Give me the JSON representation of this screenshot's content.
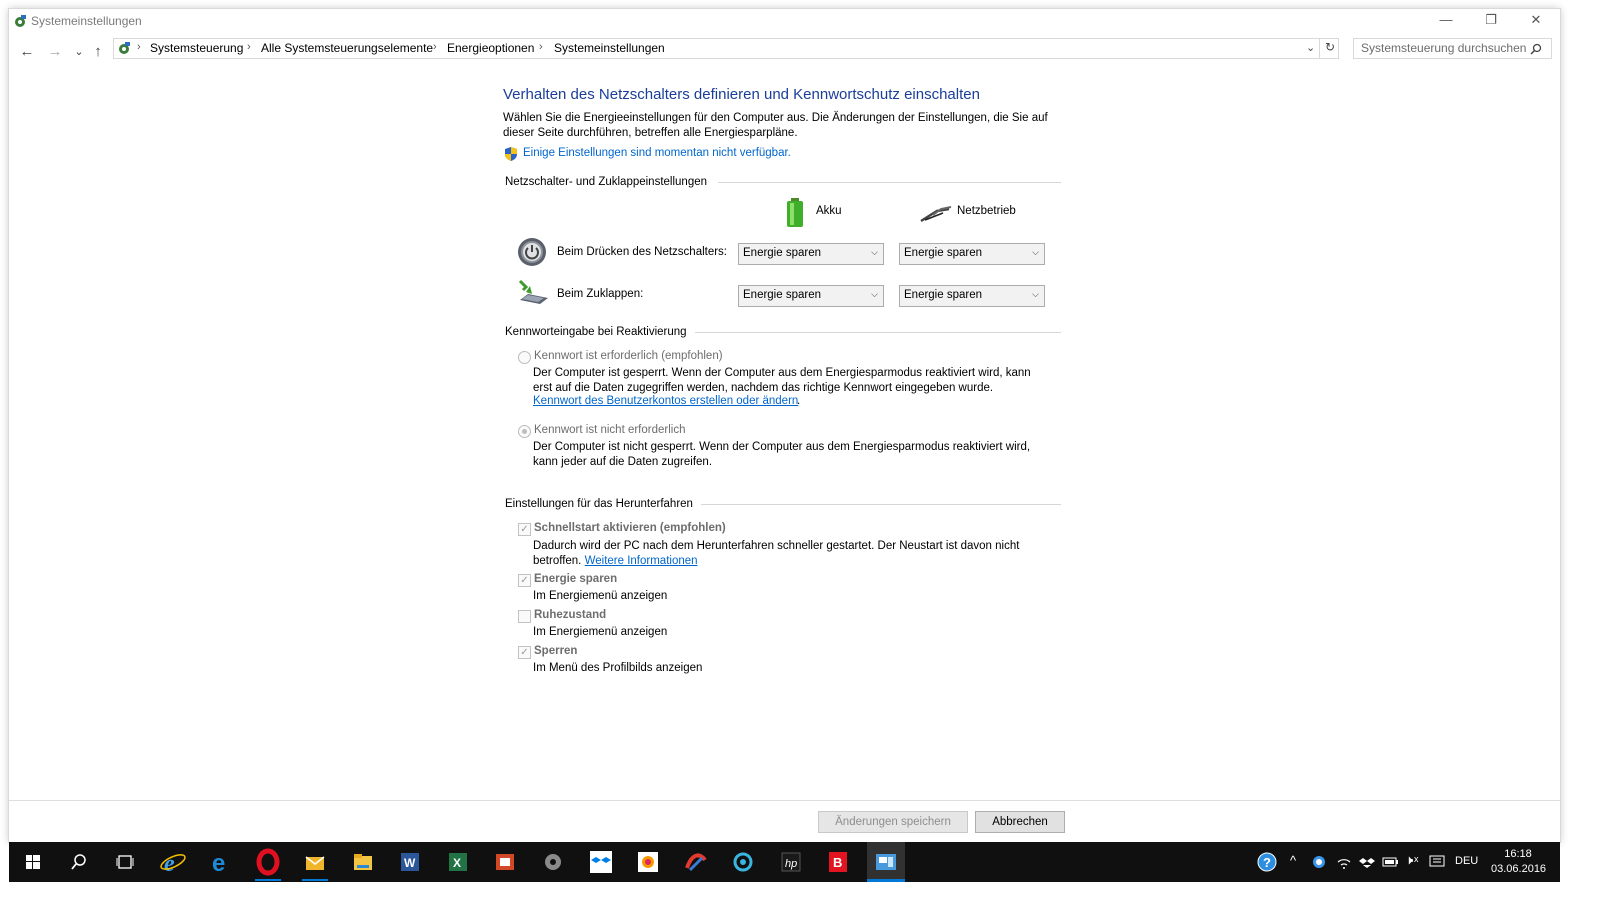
{
  "window": {
    "title": "Systemeinstellungen",
    "controls": {
      "minimize": "—",
      "restore": "❐",
      "close": "✕"
    }
  },
  "nav": {
    "back": "←",
    "forward": "→",
    "recent": "⌄",
    "up": "↑",
    "breadcrumb": [
      "Systemsteuerung",
      "Alle Systemsteuerungselemente",
      "Energieoptionen",
      "Systemeinstellungen"
    ],
    "search_placeholder": "Systemsteuerung durchsuchen"
  },
  "main": {
    "heading": "Verhalten des Netzschalters definieren und Kennwortschutz einschalten",
    "description": "Wählen Sie die Energieeinstellungen für den Computer aus. Die Änderungen der Einstellungen, die Sie auf dieser Seite durchführen, betreffen alle Energiesparpläne.",
    "admin_link": "Einige Einstellungen sind momentan nicht verfügbar.",
    "power_section": {
      "title": "Netzschalter- und Zuklappeinstellungen",
      "col_battery": "Akku",
      "col_plugged": "Netzbetrieb",
      "rows": [
        {
          "label": "Beim Drücken des Netzschalters:",
          "battery": "Energie sparen",
          "plugged": "Energie sparen"
        },
        {
          "label": "Beim Zuklappen:",
          "battery": "Energie sparen",
          "plugged": "Energie sparen"
        }
      ]
    },
    "password_section": {
      "title": "Kennworteingabe bei Reaktivierung",
      "option1_label": "Kennwort ist erforderlich (empfohlen)",
      "option1_desc": "Der Computer ist gesperrt. Wenn der Computer aus dem Energiesparmodus reaktiviert wird, kann erst auf die Daten zugegriffen werden, nachdem das richtige Kennwort eingegeben wurde.",
      "option1_link": "Kennwort des Benutzerkontos erstellen oder ändern",
      "option2_label": "Kennwort ist nicht erforderlich",
      "option2_desc": "Der Computer ist nicht gesperrt. Wenn der Computer aus dem Energiesparmodus reaktiviert wird, kann jeder auf die Daten zugreifen.",
      "selected": "Kennwort ist nicht erforderlich"
    },
    "shutdown_section": {
      "title": "Einstellungen für das Herunterfahren",
      "items": [
        {
          "label": "Schnellstart aktivieren (empfohlen)",
          "desc": "Dadurch wird der PC nach dem Herunterfahren schneller gestartet. Der Neustart ist davon nicht betroffen.",
          "link": "Weitere Informationen",
          "checked": true
        },
        {
          "label": "Energie sparen",
          "desc": "Im Energiemenü anzeigen",
          "checked": true
        },
        {
          "label": "Ruhezustand",
          "desc": "Im Energiemenü anzeigen",
          "checked": false
        },
        {
          "label": "Sperren",
          "desc": "Im Menü des Profilbilds anzeigen",
          "checked": true
        }
      ]
    }
  },
  "footer": {
    "save_button": "Änderungen speichern",
    "cancel_button": "Abbrechen"
  },
  "taskbar": {
    "language": "DEU",
    "time": "16:18",
    "date": "03.06.2016",
    "colors": {
      "background": "#101010",
      "accent": "#0078d7"
    }
  }
}
